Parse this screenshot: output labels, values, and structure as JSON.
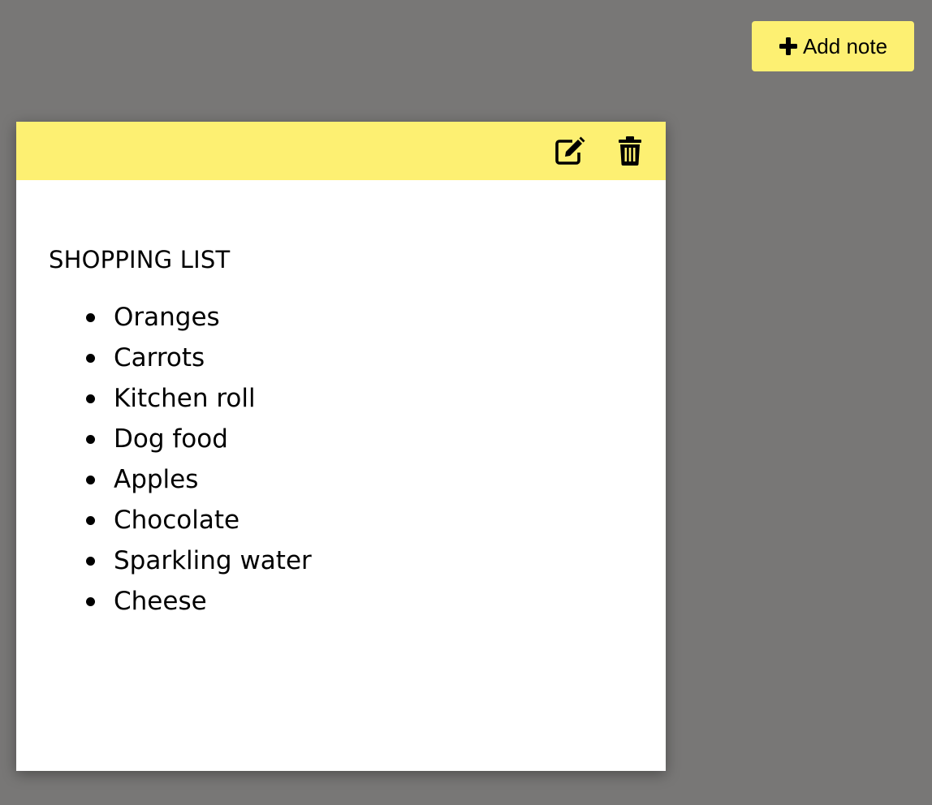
{
  "toolbar": {
    "add_note_label": "Add note",
    "add_icon": "plus-icon"
  },
  "colors": {
    "background": "#787776",
    "accent": "#fdf072",
    "note_body": "#ffffff"
  },
  "note": {
    "header_icons": [
      "edit-icon",
      "trash-icon"
    ],
    "title": "SHOPPING LIST",
    "items": [
      "Oranges",
      "Carrots",
      "Kitchen roll",
      "Dog food",
      "Apples",
      "Chocolate",
      "Sparkling water",
      "Cheese"
    ]
  }
}
